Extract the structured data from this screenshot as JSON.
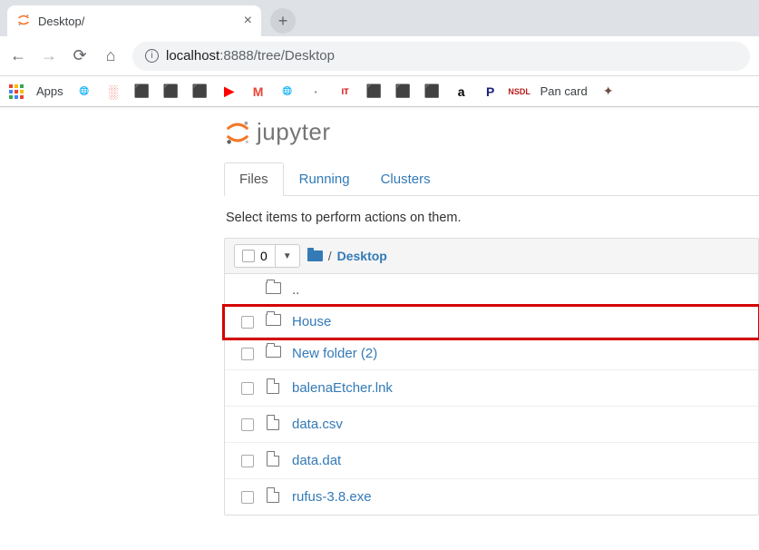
{
  "browser": {
    "tab_title": "Desktop/",
    "url_display": "localhost:8888/tree/Desktop",
    "url_host": "localhost",
    "url_rest": ":8888/tree/Desktop",
    "apps_label": "Apps",
    "bookmarks": [
      {
        "name": "globe",
        "color": "#666",
        "glyph": "🌐"
      },
      {
        "name": "wifi",
        "color": "#e8443a",
        "glyph": "░"
      },
      {
        "name": "translate",
        "color": "#4285f4",
        "glyph": "⬛"
      },
      {
        "name": "office",
        "color": "#d83b01",
        "glyph": "⬛"
      },
      {
        "name": "outlook",
        "color": "#0078d4",
        "glyph": "⬛"
      },
      {
        "name": "youtube",
        "color": "#ff0000",
        "glyph": "▶"
      },
      {
        "name": "gmail",
        "color": "#ea4335",
        "glyph": "M"
      },
      {
        "name": "globe2",
        "color": "#666",
        "glyph": "🌐"
      },
      {
        "name": "misc1",
        "color": "#888",
        "glyph": "·"
      },
      {
        "name": "it",
        "color": "#d40000",
        "glyph": "IT"
      },
      {
        "name": "misc2",
        "color": "#555",
        "glyph": "⬛"
      },
      {
        "name": "green",
        "color": "#2e7d32",
        "glyph": "⬛"
      },
      {
        "name": "red",
        "color": "#c62828",
        "glyph": "⬛"
      },
      {
        "name": "amazon",
        "color": "#000",
        "glyph": "a"
      },
      {
        "name": "p",
        "color": "#1a237e",
        "glyph": "P"
      },
      {
        "name": "nsdl",
        "color": "#b71c1c",
        "glyph": "NSDL"
      }
    ],
    "bookmark_label": "Pan card"
  },
  "jupyter": {
    "logo_text": "jupyter",
    "tabs": [
      "Files",
      "Running",
      "Clusters"
    ],
    "active_tab": 0,
    "hint": "Select items to perform actions on them.",
    "select_count": "0",
    "breadcrumb_root_icon": "folder",
    "breadcrumb_sep": "/",
    "breadcrumb_current": "Desktop",
    "items": [
      {
        "type": "up",
        "name": "..",
        "highlighted": false
      },
      {
        "type": "folder",
        "name": "House",
        "highlighted": true
      },
      {
        "type": "folder",
        "name": "New folder (2)",
        "highlighted": false
      },
      {
        "type": "file",
        "name": "balenaEtcher.lnk",
        "highlighted": false
      },
      {
        "type": "file",
        "name": "data.csv",
        "highlighted": false
      },
      {
        "type": "file",
        "name": "data.dat",
        "highlighted": false
      },
      {
        "type": "file",
        "name": "rufus-3.8.exe",
        "highlighted": false
      }
    ]
  }
}
